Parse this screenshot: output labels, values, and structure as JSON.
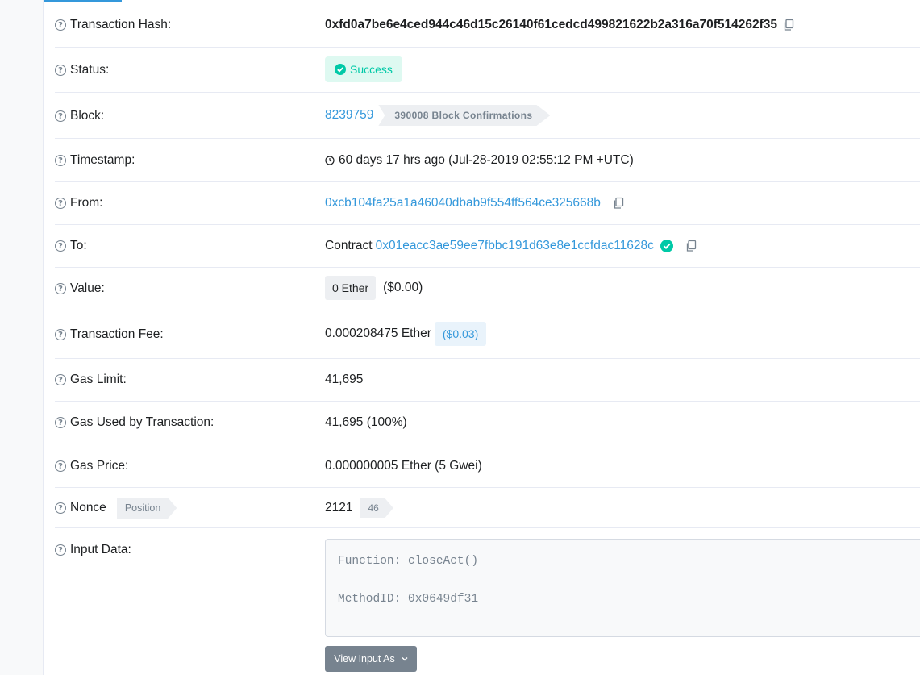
{
  "rows": {
    "tx_hash": {
      "label": "Transaction Hash:",
      "value": "0xfd0a7be6e4ced944c46d15c26140f61cedcd499821622b2a316a70f514262f35"
    },
    "status": {
      "label": "Status:",
      "value": "Success"
    },
    "block": {
      "label": "Block:",
      "number": "8239759",
      "confirmations": "390008 Block Confirmations"
    },
    "timestamp": {
      "label": "Timestamp:",
      "value": "60 days 17 hrs ago (Jul-28-2019 02:55:12 PM +UTC)"
    },
    "from": {
      "label": "From:",
      "address": "0xcb104fa25a1a46040dbab9f554ff564ce325668b"
    },
    "to": {
      "label": "To:",
      "prefix": "Contract",
      "address": "0x01eacc3ae59ee7fbbc191d63e8e1ccfdac11628c"
    },
    "value": {
      "label": "Value:",
      "amount": "0 Ether",
      "usd": "($0.00)"
    },
    "fee": {
      "label": "Transaction Fee:",
      "amount": "0.000208475 Ether",
      "usd": "($0.03)"
    },
    "gas_limit": {
      "label": "Gas Limit:",
      "value": "41,695"
    },
    "gas_used": {
      "label": "Gas Used by Transaction:",
      "value": "41,695 (100%)"
    },
    "gas_price": {
      "label": "Gas Price:",
      "value": "0.000000005 Ether (5 Gwei)"
    },
    "nonce": {
      "label": "Nonce",
      "position_tag": "Position",
      "value": "2121",
      "position": "46"
    },
    "input": {
      "label": "Input Data:",
      "function_line": "Function: closeAct()",
      "method_line": "MethodID: 0x0649df31",
      "button_label": "View Input As"
    }
  },
  "colors": {
    "link": "#3498db",
    "success": "#00c9a7",
    "muted": "#77838f"
  }
}
